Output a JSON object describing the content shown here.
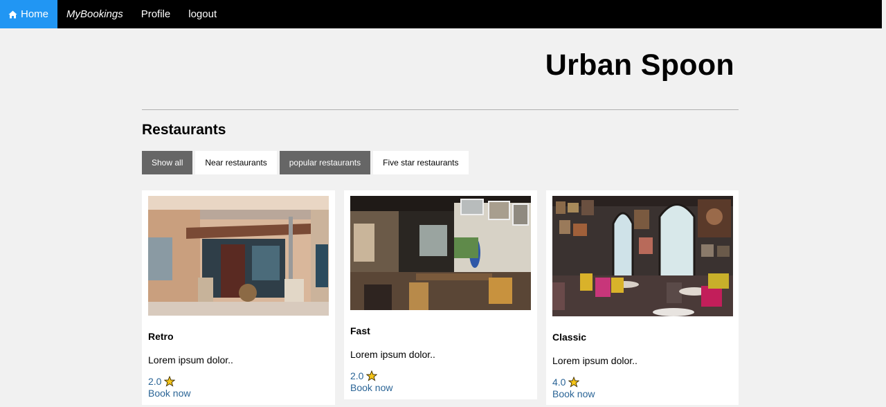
{
  "nav": {
    "home_label": "Home",
    "bookings_label": "MyBookings",
    "profile_label": "Profile",
    "logout_label": "logout"
  },
  "header": {
    "title": "Urban Spoon"
  },
  "restaurants": {
    "heading": "Restaurants",
    "filters": [
      "Show all",
      "Near restaurants",
      "popular restaurants",
      "Five star restaurants"
    ],
    "cards": [
      {
        "name": "Retro",
        "description": "Lorem ipsum dolor..",
        "rating": "2.0",
        "book_label": "Book now"
      },
      {
        "name": "Fast",
        "description": "Lorem ipsum dolor..",
        "rating": "2.0",
        "book_label": "Book now"
      },
      {
        "name": "Classic",
        "description": "Lorem ipsum dolor..",
        "rating": "4.0",
        "book_label": "Book now"
      }
    ]
  },
  "colors": {
    "nav_bg": "#000000",
    "nav_active": "#2196F3",
    "filter_dark": "#666666",
    "link": "#2a6496",
    "star": "#f5c518"
  }
}
